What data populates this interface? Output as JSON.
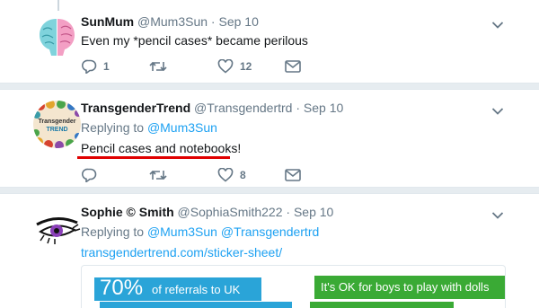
{
  "tweets": [
    {
      "name": "SunMum",
      "handle": "@Mum3Sun",
      "dot": "·",
      "date": "Sep 10",
      "text": "Even my *pencil cases* became perilous",
      "reply_count": "1",
      "retweet_count": "",
      "like_count": "12"
    },
    {
      "name": "TransgenderTrend",
      "handle": "@Transgendertrd",
      "dot": "·",
      "date": "Sep 10",
      "replying_label": "Replying to",
      "replying_to": "@Mum3Sun",
      "text": "Pencil cases and notebooks!",
      "reply_count": "",
      "retweet_count": "",
      "like_count": "8",
      "avatar_text_1": "Transgender",
      "avatar_text_2": "TREND"
    },
    {
      "name": "Sophie © Smith",
      "handle": "@SophiaSmith222",
      "dot": "·",
      "date": "Sep 10",
      "replying_label": "Replying to",
      "replying_to_1": "@Mum3Sun",
      "replying_to_2": "@Transgendertrd",
      "link": "transgendertrend.com/sticker-sheet/",
      "card": {
        "percent": "70%",
        "referrals_text": "of referrals to UK",
        "ok_text": "It's OK for boys to play with dolls"
      }
    }
  ],
  "colors": {
    "accent": "#1da1f2",
    "muted": "#657786",
    "separator": "#e6ecf0",
    "highlight_underline": "#e00000"
  },
  "icons": [
    "reply-icon",
    "retweet-icon",
    "like-icon",
    "direct-message-icon",
    "chevron-down-icon"
  ]
}
